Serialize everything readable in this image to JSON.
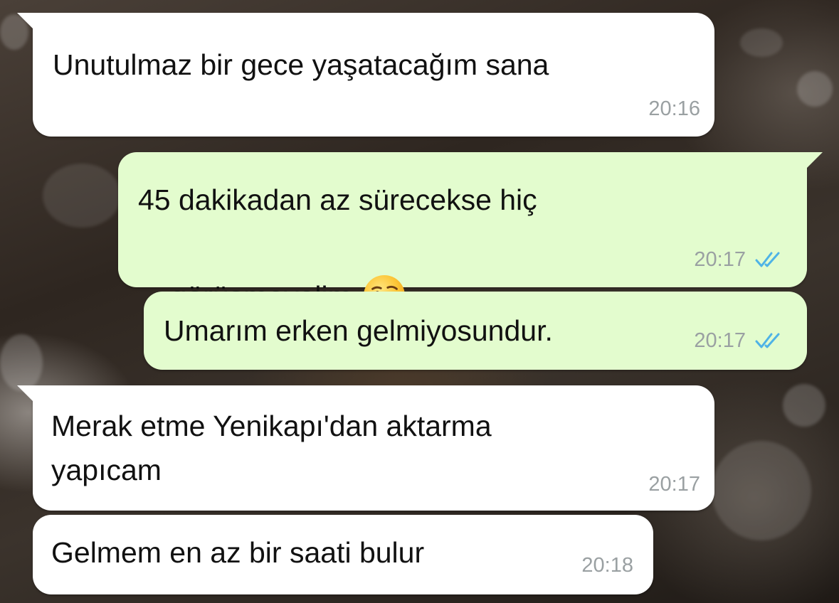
{
  "messages": [
    {
      "direction": "incoming",
      "text": "Unutulmaz bir gece yaşatacağım sana",
      "time": "20:16"
    },
    {
      "direction": "outgoing",
      "text_line1": "45 dakikadan az sürecekse hiç",
      "text_line2": "görüşmeyelim",
      "emoji": "winking-face-emoji",
      "time": "20:17",
      "status": "read"
    },
    {
      "direction": "outgoing",
      "text": "Umarım erken gelmiyosundur.",
      "time": "20:17",
      "status": "read"
    },
    {
      "direction": "incoming",
      "text_line1": "Merak etme Yenikapı'dan aktarma",
      "text_line2": "yapıcam",
      "time": "20:17"
    },
    {
      "direction": "incoming",
      "text": "Gelmem en az bir saati bulur",
      "time": "20:18"
    }
  ],
  "colors": {
    "incoming_bubble": "#ffffff",
    "outgoing_bubble": "#e3fcce",
    "timestamp": "#9aa0a2",
    "read_ticks": "#4fb3e6"
  },
  "icons": {
    "read_status": "double-check-icon"
  }
}
